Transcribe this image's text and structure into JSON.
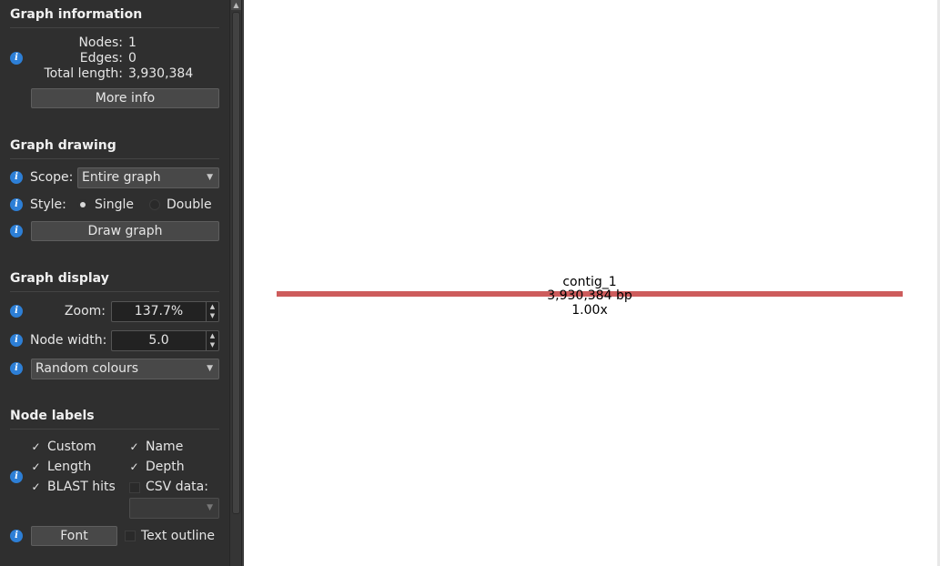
{
  "graph_information": {
    "title": "Graph information",
    "nodes_label": "Nodes:",
    "nodes_value": "1",
    "edges_label": "Edges:",
    "edges_value": "0",
    "total_length_label": "Total length:",
    "total_length_value": "3,930,384",
    "more_info_button": "More info"
  },
  "graph_drawing": {
    "title": "Graph drawing",
    "scope_label": "Scope:",
    "scope_value": "Entire graph",
    "style_label": "Style:",
    "style_single": "Single",
    "style_double": "Double",
    "style_selected": "Single",
    "draw_button": "Draw graph"
  },
  "graph_display": {
    "title": "Graph display",
    "zoom_label": "Zoom:",
    "zoom_value": "137.7%",
    "node_width_label": "Node width:",
    "node_width_value": "5.0",
    "colour_scheme": "Random colours"
  },
  "node_labels": {
    "title": "Node labels",
    "custom": {
      "label": "Custom",
      "checked": true
    },
    "name": {
      "label": "Name",
      "checked": true
    },
    "length": {
      "label": "Length",
      "checked": true
    },
    "depth": {
      "label": "Depth",
      "checked": true
    },
    "blast_hits": {
      "label": "BLAST hits",
      "checked": true
    },
    "csv_data": {
      "label": "CSV data:",
      "checked": false
    },
    "csv_select_value": "",
    "font_button": "Font",
    "text_outline": {
      "label": "Text outline",
      "checked": false
    }
  },
  "graph": {
    "node_color": "#cd5c5c",
    "node": {
      "name": "contig_1",
      "length": "3,930,384 bp",
      "depth": "1.00x"
    }
  },
  "icons": {
    "info": "info-icon",
    "check": "check-mark-icon",
    "dropdown": "chevron-down-icon",
    "spin": "spin-arrows-icon"
  }
}
